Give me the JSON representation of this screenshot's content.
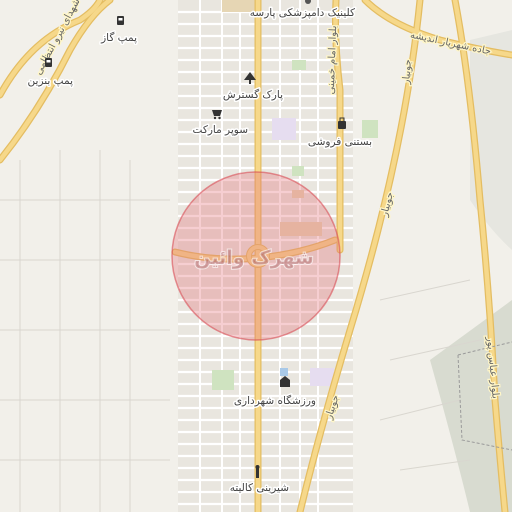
{
  "map": {
    "highlight_label": "شهرک وائین",
    "colors": {
      "background": "#f2f0ea",
      "major_road": "#f6d88a",
      "major_road_casing": "#e4bd62",
      "minor_road": "#ffffff",
      "block": "#e9e6df",
      "park": "#cfe3c0",
      "campus": "#e6ddf0",
      "highlight_fill": "#e4737a",
      "highlight_stroke": "#d84d55",
      "dark_terrain": "#d8dbd0"
    },
    "pois": [
      {
        "name": "کلینیک دامپزشکی پارسه",
        "icon": "clinic-icon"
      },
      {
        "name": "پمپ گاز",
        "icon": "fuel-pump-icon"
      },
      {
        "name": "پمپ بنزین",
        "icon": "fuel-pump-icon"
      },
      {
        "name": "پارک گسترش",
        "icon": "tree-icon"
      },
      {
        "name": "سوپر مارکت",
        "icon": "shopping-cart-icon"
      },
      {
        "name": "بستنی فروشی",
        "icon": "shopping-bag-icon"
      },
      {
        "name": "ورزشگاه شهرداری",
        "icon": "stadium-icon"
      },
      {
        "name": "شیرینی کالیته",
        "icon": "bakery-icon"
      }
    ],
    "roads": [
      {
        "name": "شهدای نیرو انتظامی"
      },
      {
        "name": "جاده شهریار اندیشه"
      },
      {
        "name": "بلوار امام خمینی"
      },
      {
        "name": "جوبیار"
      },
      {
        "name": "جوبیار"
      },
      {
        "name": "جوبیار"
      },
      {
        "name": "بلوار عباس پور"
      }
    ]
  }
}
